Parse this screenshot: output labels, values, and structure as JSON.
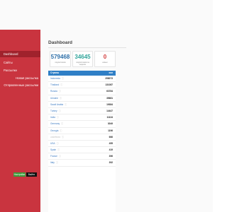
{
  "sidebar": {
    "items": [
      {
        "label": "Dashboard",
        "active": true,
        "sub": false
      },
      {
        "label": "Сайты",
        "active": false,
        "sub": false
      },
      {
        "label": "Рассылки",
        "active": false,
        "sub": false
      },
      {
        "label": "Новая рассылка",
        "active": false,
        "sub": true
      },
      {
        "label": "Отправленные рассылки",
        "active": false,
        "sub": true
      }
    ],
    "buttons": {
      "green": "Настройки",
      "dark": "Выйти"
    }
  },
  "page": {
    "title": "Dashboard"
  },
  "stats": [
    {
      "value": "579468",
      "label": "подписчиков",
      "color": "#2e6fa8"
    },
    {
      "value": "34645",
      "label": "подписчиков за неделю",
      "color": "#2fa49a"
    },
    {
      "value": "0",
      "label": "новых",
      "color": "#d23b3b"
    }
  ],
  "table": {
    "headers": {
      "country": "Страны",
      "count": "кол"
    },
    "rows": [
      {
        "country": "Indonesia",
        "count": "298073",
        "faded": false
      },
      {
        "country": "Thailand",
        "count": "131087",
        "faded": false
      },
      {
        "country": "Russia",
        "count": "63784",
        "faded": false
      },
      {
        "country": "Ukraine",
        "count": "35681",
        "faded": false
      },
      {
        "country": "Saudi Arabia",
        "count": "19384",
        "faded": false
      },
      {
        "country": "Turkey",
        "count": "14447",
        "faded": false
      },
      {
        "country": "India",
        "count": "11134",
        "faded": false
      },
      {
        "country": "Germany",
        "count": "3049",
        "faded": false
      },
      {
        "country": "Georgia",
        "count": "1196",
        "faded": false
      },
      {
        "country": "undefined",
        "count": "666",
        "faded": true
      },
      {
        "country": "USA",
        "count": "455",
        "faded": false
      },
      {
        "country": "Spain",
        "count": "419",
        "faded": false
      },
      {
        "country": "France",
        "count": "396",
        "faded": false
      },
      {
        "country": "Italy",
        "count": "392",
        "faded": false
      }
    ]
  }
}
